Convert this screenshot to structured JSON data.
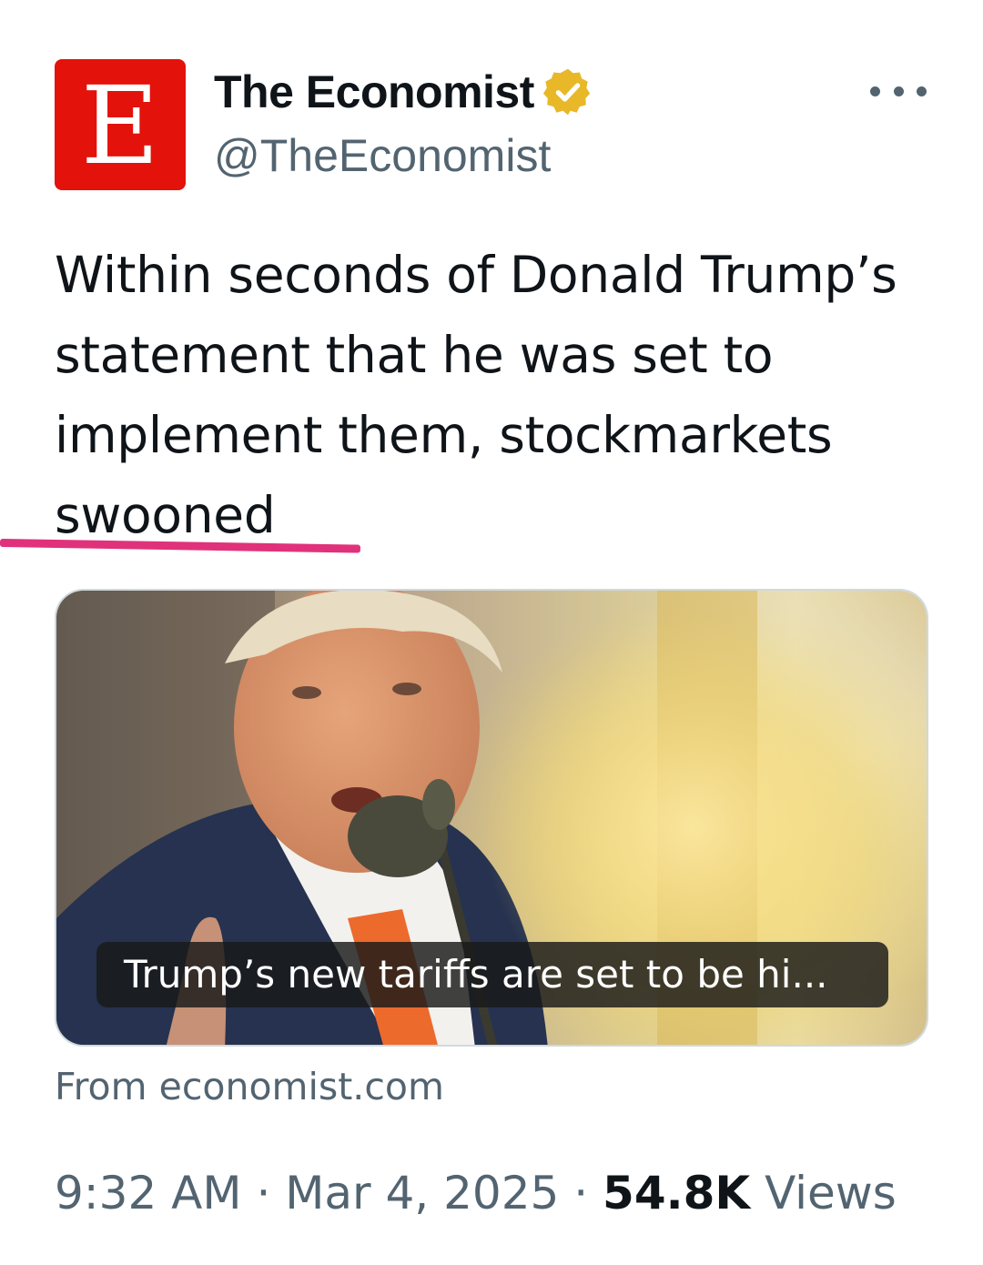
{
  "author": {
    "avatar_letter": "E",
    "display_name": "The Economist",
    "handle": "@TheEconomist",
    "verified_icon": "gold-verified-badge-icon",
    "brand_color": "#e3120b",
    "verified_color": "#e8b829"
  },
  "more_icon": "more-options-dots-icon",
  "tweet": {
    "text": "Within seconds of Donald Trump’s statement that he was set to implement them, stockmarkets swooned",
    "highlight_color": "#e0327a"
  },
  "link_card": {
    "image_description_icon": "speaker-at-microphone-photo",
    "caption": "Trump’s new tariffs are set to be hi...",
    "source": "From economist.com"
  },
  "meta": {
    "time": "9:32 AM",
    "separator": "·",
    "date": "Mar 4, 2025",
    "views_count": "54.8K",
    "views_label": "Views"
  }
}
